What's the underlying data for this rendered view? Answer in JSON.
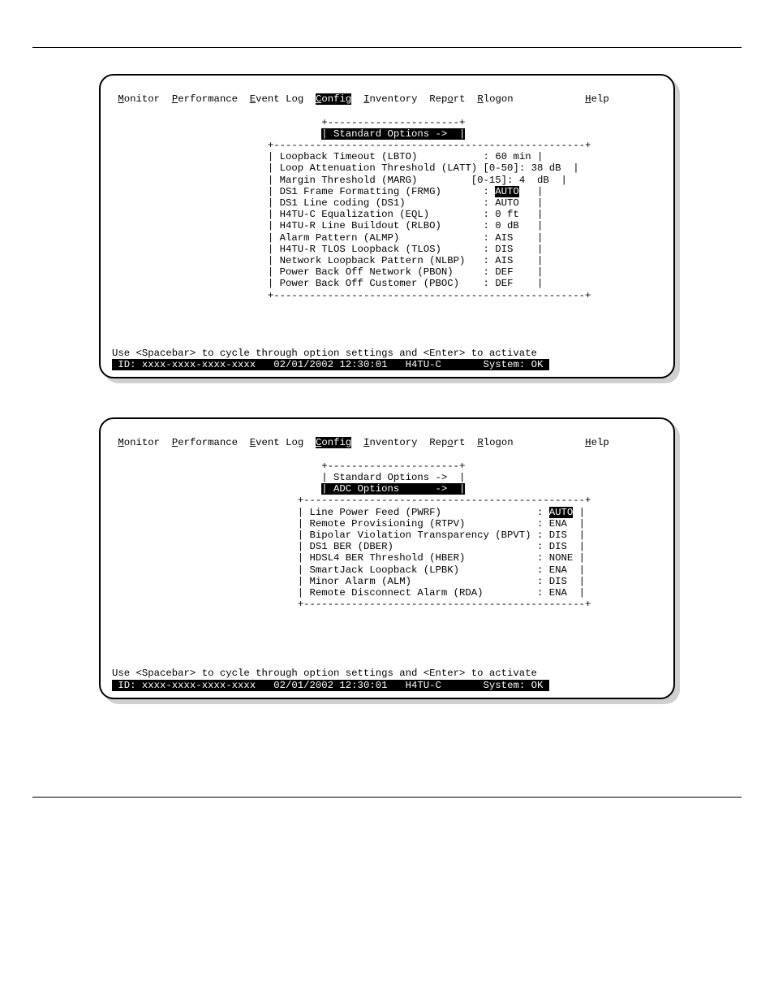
{
  "header_left": "",
  "header_right": "",
  "section1_title": "",
  "section2_title": "",
  "menu": [
    {
      "hot": "M",
      "rest": "onitor"
    },
    {
      "hot": "P",
      "rest": "erformance"
    },
    {
      "hot": "E",
      "rest": "vent Log"
    },
    {
      "hot": "C",
      "rest": "onfig",
      "selected": true
    },
    {
      "hot": "I",
      "rest": "nventory"
    },
    {
      "hot_mid": "o",
      "pre": "Rep",
      "rest": "rt"
    },
    {
      "hot": "R",
      "rest": "logon"
    },
    {
      "hot": "H",
      "rest": "elp",
      "right": true
    }
  ],
  "screen1": {
    "submenu_border_top": "+----------------------+",
    "submenu_line": "| Standard Options ->  |",
    "box_top": "+----------------------------------------------------+",
    "options": [
      {
        "label": "Loopback Timeout (LBTO)",
        "pad": "           ",
        "val": "60 min"
      },
      {
        "label": "Loop Attenuation Threshold (LATT) [0-50]",
        "colon_override": ": ",
        "no_std_colon": true,
        "val": "38 dB"
      },
      {
        "label": "Margin Threshold (MARG)         [0-15]",
        "colon_override": ": ",
        "no_std_colon": true,
        "val": "4  dB"
      },
      {
        "label": "DS1 Frame Formatting (FRMG)",
        "pad": "       ",
        "val": "AUTO",
        "sel": true
      },
      {
        "label": "DS1 Line coding (DS1)",
        "pad": "             ",
        "val": "AUTO"
      },
      {
        "label": "H4TU-C Equalization (EQL)",
        "pad": "         ",
        "val": "0 ft"
      },
      {
        "label": "H4TU-R Line Buildout (RLBO)",
        "pad": "       ",
        "val": "0 dB"
      },
      {
        "label": "Alarm Pattern (ALMP)",
        "pad": "              ",
        "val": "AIS"
      },
      {
        "label": "H4TU-R TLOS Loopback (TLOS)",
        "pad": "       ",
        "val": "DIS"
      },
      {
        "label": "Network Loopback Pattern (NLBP)",
        "pad": "   ",
        "val": "AIS"
      },
      {
        "label": "Power Back Off Network (PBON)",
        "pad": "     ",
        "val": "DEF"
      },
      {
        "label": "Power Back Off Customer (PBOC)",
        "pad": "    ",
        "val": "DEF"
      }
    ],
    "box_bottom": "+----------------------------------------------------+"
  },
  "screen2": {
    "submenu_border_top": "+----------------------+",
    "submenu_line1": "| Standard Options ->  |",
    "submenu_line2": "| ADC Options      ->  |",
    "box_top": "+-----------------------------------------------+",
    "options": [
      {
        "label": "Line Power Feed (PWRF)",
        "pad": "                ",
        "val": "AUTO",
        "sel": true
      },
      {
        "label": "Remote Provisioning (RTPV)",
        "pad": "            ",
        "val": "ENA"
      },
      {
        "label": "Bipolar Violation Transparency (BPVT)",
        "pad": " ",
        "val": "DIS"
      },
      {
        "label": "DS1 BER (DBER)",
        "pad": "                        ",
        "val": "DIS"
      },
      {
        "label": "HDSL4 BER Threshold (HBER)",
        "pad": "            ",
        "val": "NONE"
      },
      {
        "label": "SmartJack Loopback (LPBK)",
        "pad": "             ",
        "val": "ENA"
      },
      {
        "label": "Minor Alarm (ALM)",
        "pad": "                     ",
        "val": "DIS"
      },
      {
        "label": "Remote Disconnect Alarm (RDA)",
        "pad": "         ",
        "val": "ENA"
      }
    ],
    "box_bottom": "+-----------------------------------------------+"
  },
  "hint": "Use <Spacebar> to cycle through option settings and <Enter> to activate",
  "status": {
    "id": " ID: xxxx-xxxx-xxxx-xxxx",
    "date": "02/01/2002 12:30:01",
    "unit": "H4TU-C",
    "system": "System: OK "
  },
  "caption1_text": "",
  "caption2_text": "",
  "footer_left": "",
  "footer_right": ""
}
